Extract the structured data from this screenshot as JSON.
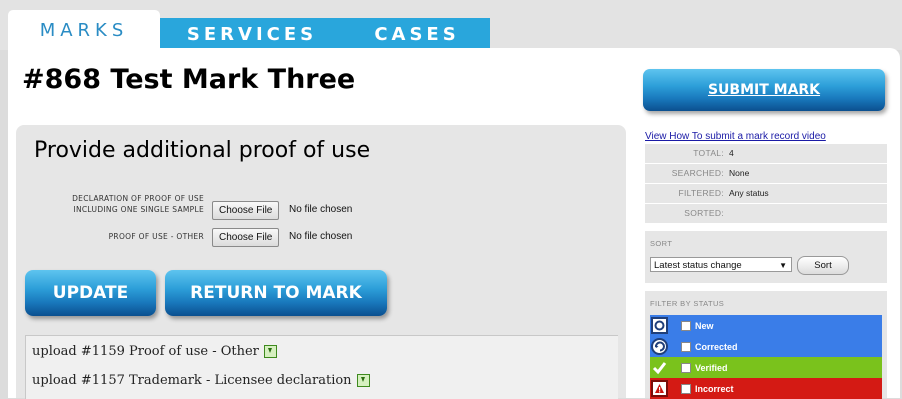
{
  "tabs": [
    {
      "label": "MARKS",
      "active": true
    },
    {
      "label": "SERVICES",
      "active": false
    },
    {
      "label": "CASES",
      "active": false
    }
  ],
  "page_title": "#868 Test Mark Three",
  "proof": {
    "heading": "Provide additional proof of use",
    "fields": [
      {
        "label_line1": "DECLARATION OF PROOF OF USE",
        "label_line2": "INCLUDING ONE SINGLE SAMPLE",
        "button": "Choose File",
        "status": "No file chosen"
      },
      {
        "label_line1": "PROOF OF USE - OTHER",
        "button": "Choose File",
        "status": "No file chosen"
      }
    ],
    "update_label": "UPDATE",
    "return_label": "RETURN TO MARK"
  },
  "uploads": [
    {
      "text": "upload #1159 Proof of use - Other"
    },
    {
      "text": "upload #1157 Trademark - Licensee declaration"
    }
  ],
  "sidebar": {
    "submit_label": "SUBMIT MARK",
    "video_link": "View How To submit a mark record video",
    "stats": [
      {
        "key": "TOTAL:",
        "value": "4"
      },
      {
        "key": "SEARCHED:",
        "value": "None"
      },
      {
        "key": "FILTERED:",
        "value": "Any status"
      },
      {
        "key": "SORTED:",
        "value": ""
      }
    ],
    "sort_caption": "SORT",
    "sort_selected": "Latest status change",
    "sort_button": "Sort",
    "filter_caption": "FILTER BY STATUS",
    "filters": [
      {
        "label": "New",
        "color": "#3a7de8",
        "icon": "new-status-icon"
      },
      {
        "label": "Corrected",
        "color": "#3a7de8",
        "icon": "corrected-status-icon"
      },
      {
        "label": "Verified",
        "color": "#7ac21c",
        "icon": "verified-check-icon"
      },
      {
        "label": "Incorrect",
        "color": "#d41a14",
        "icon": "incorrect-warning-icon"
      }
    ]
  },
  "colors": {
    "tab_blue": "#29a6dc",
    "button_blue": "#1979bd",
    "link": "#1a1aa6"
  }
}
